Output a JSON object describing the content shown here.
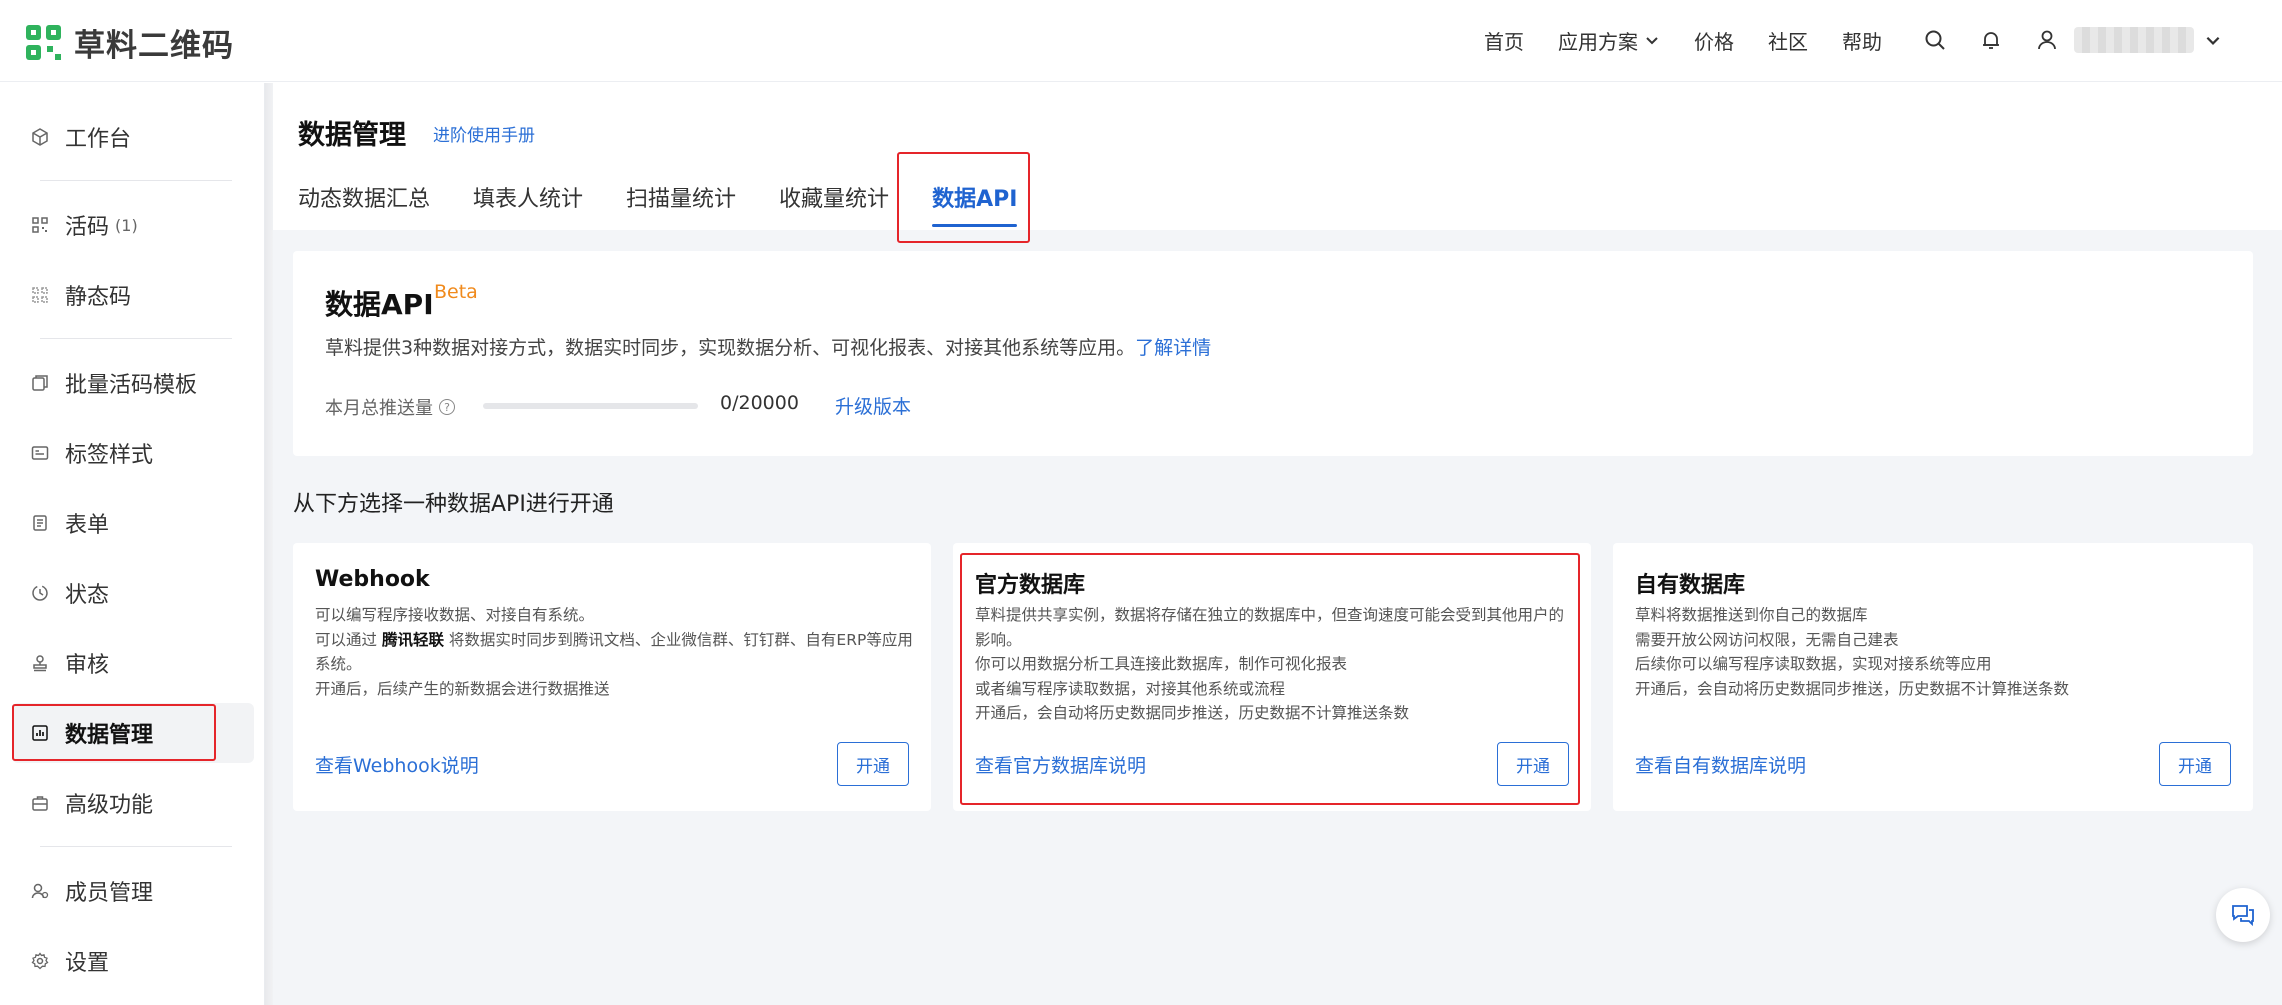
{
  "brand": {
    "name": "草料二维码",
    "accent": "#2fb35d"
  },
  "topnav": {
    "home": "首页",
    "solutions": "应用方案",
    "price": "价格",
    "community": "社区",
    "help": "帮助",
    "icons": [
      "search-icon",
      "bell-icon",
      "user-icon",
      "chevron-down-icon"
    ]
  },
  "sidebar": {
    "items": [
      {
        "label": "工作台",
        "icon": "cube-icon"
      },
      {
        "label": "活码",
        "count": "(1)",
        "icon": "qr-icon"
      },
      {
        "label": "静态码",
        "icon": "qr-icon"
      },
      {
        "label": "批量活码模板",
        "icon": "copy-icon"
      },
      {
        "label": "标签样式",
        "icon": "label-icon"
      },
      {
        "label": "表单",
        "icon": "form-icon"
      },
      {
        "label": "状态",
        "icon": "status-icon"
      },
      {
        "label": "审核",
        "icon": "stamp-icon"
      },
      {
        "label": "数据管理",
        "icon": "chart-icon",
        "active": true
      },
      {
        "label": "高级功能",
        "icon": "briefcase-icon"
      },
      {
        "label": "成员管理",
        "icon": "members-icon"
      },
      {
        "label": "设置",
        "icon": "gear-icon"
      }
    ]
  },
  "page": {
    "title": "数据管理",
    "manual_link": "进阶使用手册",
    "tabs": [
      "动态数据汇总",
      "填表人统计",
      "扫描量统计",
      "收藏量统计",
      "数据API"
    ],
    "active_tab": 4
  },
  "api": {
    "title": "数据API",
    "badge": "Beta",
    "desc": "草料提供3种数据对接方式，数据实时同步，实现数据分析、可视化报表、对接其他系统等应用。",
    "desc_link": "了解详情",
    "push_label": "本月总推送量",
    "push_used": 0,
    "push_limit": 20000,
    "push_value": "0/20000",
    "upgrade": "升级版本"
  },
  "choose_text": "从下方选择一种数据API进行开通",
  "options": [
    {
      "title": "Webhook",
      "line1": "可以编写程序接收数据、对接自有系统。",
      "line2_pre": "可以通过",
      "line2_bold": "腾讯轻联",
      "line2_post": "将数据实时同步到腾讯文档、企业微信群、钉钉群、自有ERP等应用系统。",
      "line3": "开通后，后续产生的新数据会进行数据推送",
      "link": "查看Webhook说明",
      "button": "开通"
    },
    {
      "title": "官方数据库",
      "line1": "草料提供共享实例，数据将存储在独立的数据库中，但查询速度可能会受到其他用户的影响。",
      "line2": "你可以用数据分析工具连接此数据库，制作可视化报表",
      "line3": "或者编写程序读取数据，对接其他系统或流程",
      "line4": "开通后，会自动将历史数据同步推送，历史数据不计算推送条数",
      "link": "查看官方数据库说明",
      "button": "开通"
    },
    {
      "title": "自有数据库",
      "line1": "草料将数据推送到你自己的数据库",
      "line2": "需要开放公网访问权限，无需自己建表",
      "line3": "后续你可以编写程序读取数据，实现对接系统等应用",
      "line4": "开通后，会自动将历史数据同步推送，历史数据不计算推送条数",
      "link": "查看自有数据库说明",
      "button": "开通"
    }
  ],
  "colors": {
    "link": "#2b6fd6",
    "active_tab": "#1f63d0",
    "highlight": "#e5252a",
    "beta": "#f08a1c"
  }
}
